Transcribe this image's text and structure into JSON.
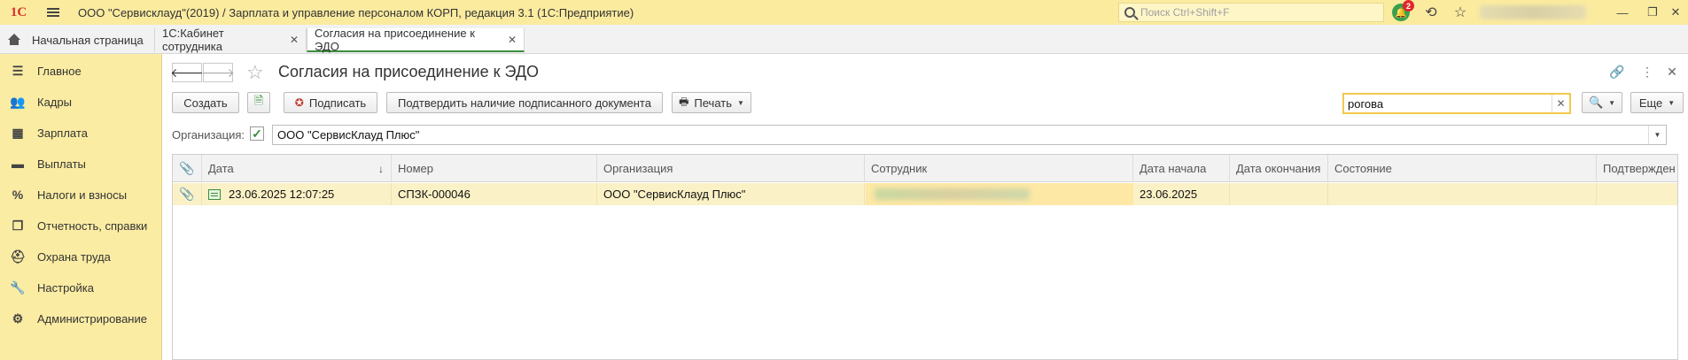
{
  "titlebar": {
    "logo": "1С",
    "title": "ООО \"Сервисклауд\"(2019) / Зарплата и управление персоналом КОРП, редакция 3.1  (1С:Предприятие)",
    "search_placeholder": "Поиск Ctrl+Shift+F",
    "notifications_count": "2"
  },
  "tabs": {
    "home": "Начальная страница",
    "t2": "1С:Кабинет сотрудника",
    "active": "Согласия на присоединение к ЭДО"
  },
  "sidebar": {
    "items": [
      {
        "label": "Главное",
        "icon": "menu-icon"
      },
      {
        "label": "Кадры",
        "icon": "people-icon"
      },
      {
        "label": "Зарплата",
        "icon": "calculator-icon"
      },
      {
        "label": "Выплаты",
        "icon": "wallet-icon"
      },
      {
        "label": "Налоги и взносы",
        "icon": "percent-icon"
      },
      {
        "label": "Отчетность, справки",
        "icon": "reports-icon"
      },
      {
        "label": "Охрана труда",
        "icon": "helmet-icon"
      },
      {
        "label": "Настройка",
        "icon": "wrench-icon"
      },
      {
        "label": "Администрирование",
        "icon": "gear-icon"
      }
    ]
  },
  "form": {
    "title": "Согласия на присоединение к ЭДО",
    "toolbar": {
      "create": "Создать",
      "sign": "Подписать",
      "confirm": "Подтвердить наличие подписанного документа",
      "print": "Печать",
      "more": "Еще"
    },
    "search_value": "рогова",
    "org_label": "Организация:",
    "org_value": "ООО \"СервисКлауд Плюс\""
  },
  "table": {
    "columns": [
      "Дата",
      "Номер",
      "Организация",
      "Сотрудник",
      "Дата начала",
      "Дата окончания",
      "Состояние",
      "Подтвержден"
    ],
    "rows": [
      {
        "date": "23.06.2025 12:07:25",
        "number": "СПЗК-000046",
        "organization": "ООО \"СервисКлауд Плюс\"",
        "employee": "",
        "start": "23.06.2025",
        "end": "",
        "state": "",
        "confirmed": ""
      }
    ]
  }
}
